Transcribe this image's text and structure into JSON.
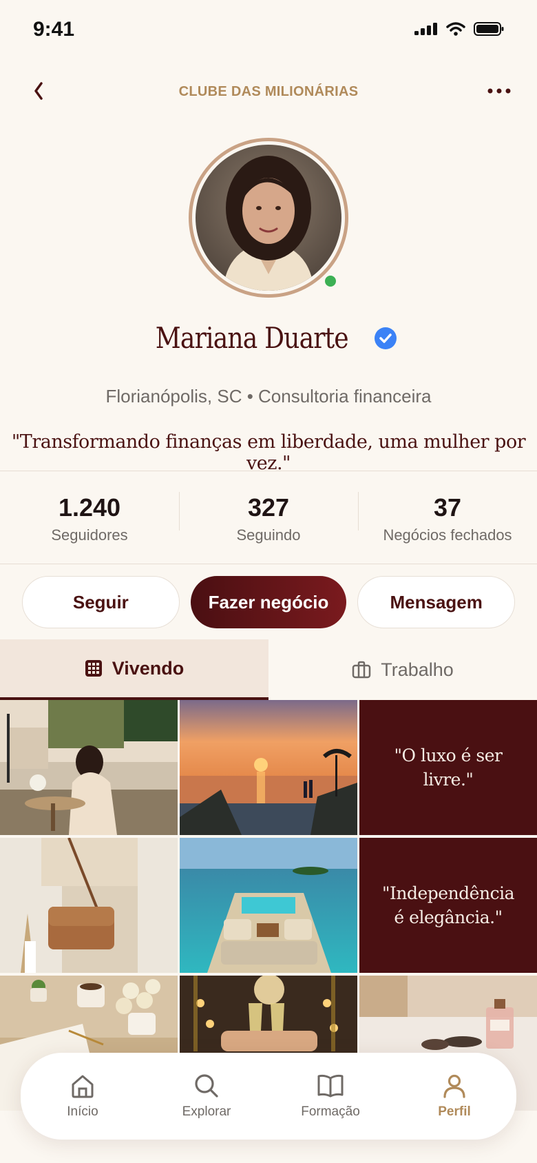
{
  "status_bar": {
    "time": "9:41"
  },
  "header": {
    "title": "CLUBE DAS MILIONÁRIAS"
  },
  "profile": {
    "name": "Mariana Duarte",
    "location": "Florianópolis, SC • Consultoria financeira",
    "bio": "\"Transformando finanças em liberdade, uma mulher por vez.\"",
    "online": true,
    "verified": true
  },
  "stats": [
    {
      "value": "1.240",
      "label": "Seguidores"
    },
    {
      "value": "327",
      "label": "Seguindo"
    },
    {
      "value": "37",
      "label": "Negócios fechados"
    }
  ],
  "actions": {
    "follow": "Seguir",
    "deal": "Fazer negócio",
    "message": "Mensagem"
  },
  "tabs": [
    {
      "label": "Vivendo",
      "active": true
    },
    {
      "label": "Trabalho",
      "active": false
    }
  ],
  "grid": [
    {
      "type": "photo",
      "subject": "cafe-terrace"
    },
    {
      "type": "photo",
      "subject": "sunset-infinity-pool"
    },
    {
      "type": "quote",
      "text": "\"O luxo é ser livre.\""
    },
    {
      "type": "photo",
      "subject": "leather-handbag"
    },
    {
      "type": "photo",
      "subject": "yacht-deck"
    },
    {
      "type": "quote",
      "text": "\"Independência é elegância.\""
    },
    {
      "type": "photo",
      "subject": "desk-roses-notebook"
    },
    {
      "type": "photo",
      "subject": "champagne-toast"
    },
    {
      "type": "photo",
      "subject": "perfume-sunglasses"
    }
  ],
  "bottom_nav": [
    {
      "label": "Início",
      "icon": "home-icon",
      "active": false
    },
    {
      "label": "Explorar",
      "icon": "search-icon",
      "active": false
    },
    {
      "label": "Formação",
      "icon": "book-icon",
      "active": false
    },
    {
      "label": "Perfil",
      "icon": "person-icon",
      "active": true
    }
  ],
  "colors": {
    "background": "#fbf7f1",
    "burgundy": "#4a1212",
    "gold": "#b08a5a",
    "online": "#3cb054",
    "verified": "#3b82f6"
  }
}
